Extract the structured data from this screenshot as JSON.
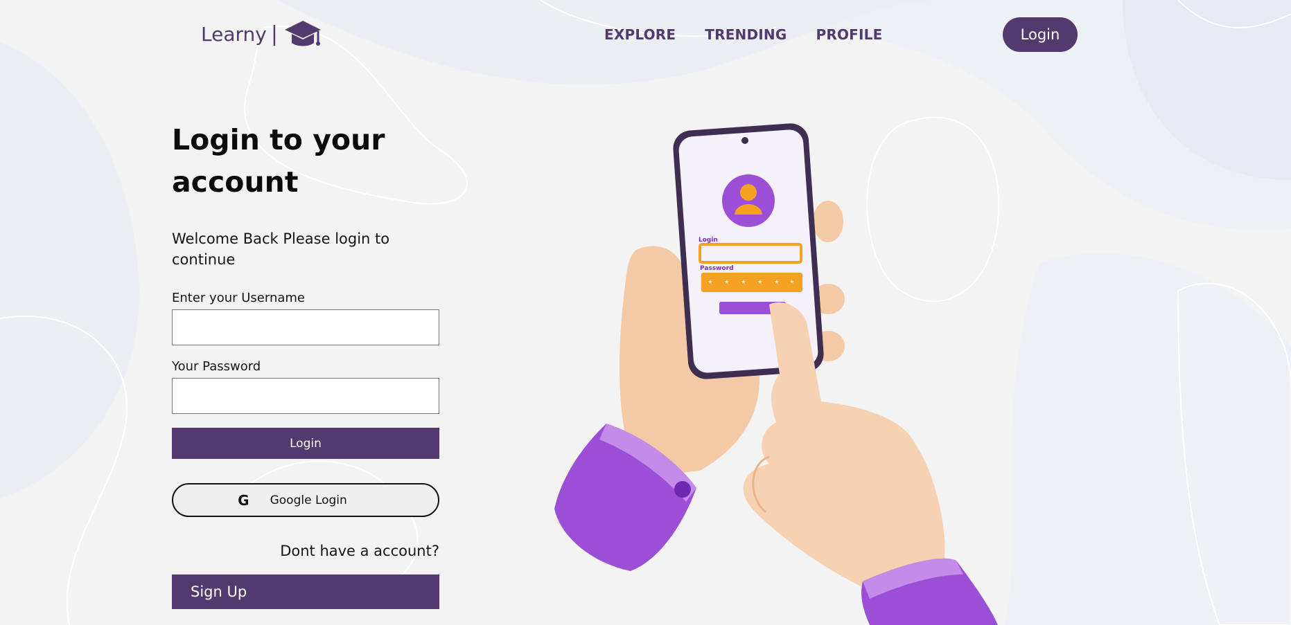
{
  "brand": {
    "name": "Learny",
    "separator": "|"
  },
  "nav": {
    "items": [
      "EXPLORE",
      "TRENDING",
      "PROFILE"
    ]
  },
  "header": {
    "login_label": "Login"
  },
  "form": {
    "title": "Login to your account",
    "subtitle": "Welcome Back Please login to continue",
    "username_label": "Enter your Username",
    "username_value": "",
    "password_label": "Your Password",
    "password_value": "",
    "login_label": "Login",
    "google_icon": "G",
    "google_label": "Google Login",
    "no_account_text": "Dont have a account?",
    "signup_label": "Sign Up"
  },
  "illustration": {
    "phone_login_label": "Login",
    "phone_password_label": "Password",
    "password_mask": [
      "*",
      "*",
      "*",
      "*",
      "*",
      "*"
    ]
  },
  "colors": {
    "accent": "#523a6f",
    "illustration_purple": "#9b4fd6",
    "orange": "#f5a122"
  },
  "icons": {
    "logo": "graduation-cap-icon",
    "google": "google-icon",
    "avatar": "user-avatar-icon"
  }
}
